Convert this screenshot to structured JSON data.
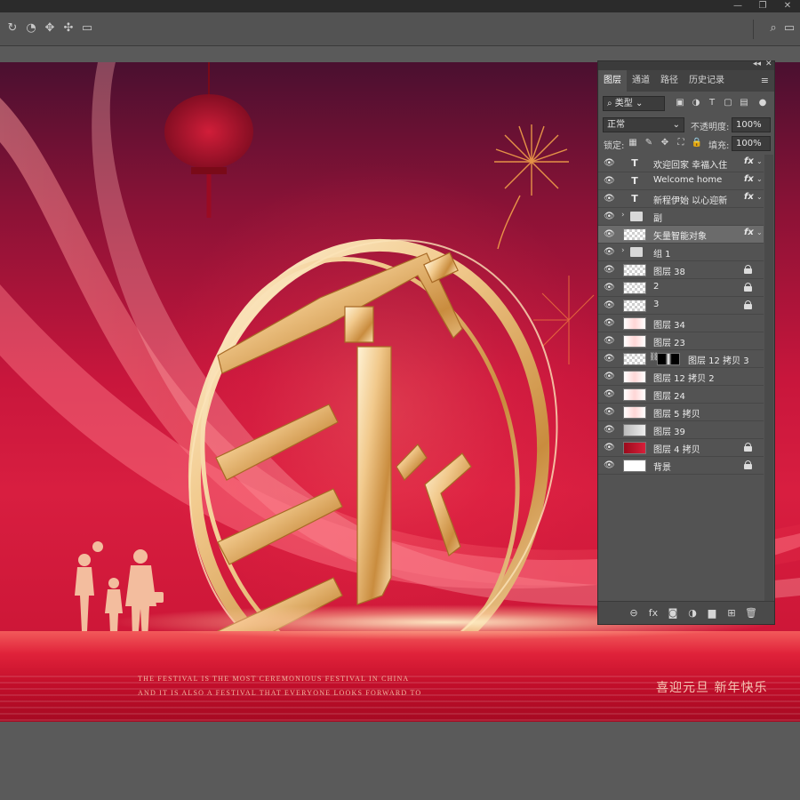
{
  "window": {
    "controls": [
      "—",
      "❐",
      "✕"
    ]
  },
  "optionsbar": {
    "icons": [
      "rotate-3d-icon",
      "roll-3d-icon",
      "drag-3d-icon",
      "slide-3d-icon",
      "scale-3d-icon"
    ],
    "icon_glyphs": [
      "↻",
      "◔",
      "✥",
      "✣",
      "▭"
    ],
    "search_glyph": "⌕",
    "workspace_glyph": "▭"
  },
  "canvas": {
    "caption_line1": "THE FESTIVAL IS THE MOST CEREMONIOUS FESTIVAL IN CHINA",
    "caption_line2": "AND IT IS ALSO A FESTIVAL THAT EVERYONE LOOKS FORWARD TO",
    "greeting": "喜迎元旦 新年快乐",
    "colors": {
      "bg_red": "#d81e40",
      "gold": "#e8b770",
      "floor": "#c10e2a"
    }
  },
  "panel": {
    "header_glyphs": [
      "◂◂",
      "✕"
    ],
    "tabs": [
      "图层",
      "通道",
      "路径",
      "历史记录"
    ],
    "active_tab": "图层",
    "menu_glyph": "≡",
    "filter_label": "类型",
    "blend_mode": "正常",
    "opacity_label": "不透明度:",
    "opacity_value": "100%",
    "lock_label": "锁定:",
    "fill_label": "填充:",
    "fill_value": "100%",
    "layers": [
      {
        "name": "欢迎回家 幸福入住",
        "kind": "text",
        "fx": "fx"
      },
      {
        "name": "Welcome home",
        "kind": "text",
        "fx": "fx"
      },
      {
        "name": "新程伊始 以心迎新",
        "kind": "text",
        "fx": "fx"
      },
      {
        "name": "副",
        "kind": "group"
      },
      {
        "name": "矢量智能对象",
        "kind": "smart",
        "fx": "fx",
        "selected": true
      },
      {
        "name": "组 1",
        "kind": "group"
      },
      {
        "name": "图层 38",
        "kind": "pixel",
        "locked": true
      },
      {
        "name": "2",
        "kind": "pixel",
        "locked": true
      },
      {
        "name": "3",
        "kind": "pixel",
        "locked": true
      },
      {
        "name": "图层 34",
        "kind": "pixel"
      },
      {
        "name": "图层 23",
        "kind": "pixel"
      },
      {
        "name": "图层 12 拷贝 3",
        "kind": "masked"
      },
      {
        "name": "图层 12 拷贝 2",
        "kind": "pixel"
      },
      {
        "name": "图层 24",
        "kind": "pixel"
      },
      {
        "name": "图层 5 拷贝",
        "kind": "pixel"
      },
      {
        "name": "图层 39",
        "kind": "pixel"
      },
      {
        "name": "图层 4 拷贝",
        "kind": "red",
        "locked": true
      },
      {
        "name": "背景",
        "kind": "white",
        "locked": true
      }
    ],
    "footer_icons": [
      "link-layers-icon",
      "fx-icon",
      "add-mask-icon",
      "adjustment-layer-icon",
      "new-group-icon",
      "new-layer-icon",
      "delete-layer-icon"
    ],
    "footer_glyphs": [
      "⊖",
      "fx",
      "◙",
      "◑",
      "▆",
      "⊞",
      "🗑"
    ]
  }
}
